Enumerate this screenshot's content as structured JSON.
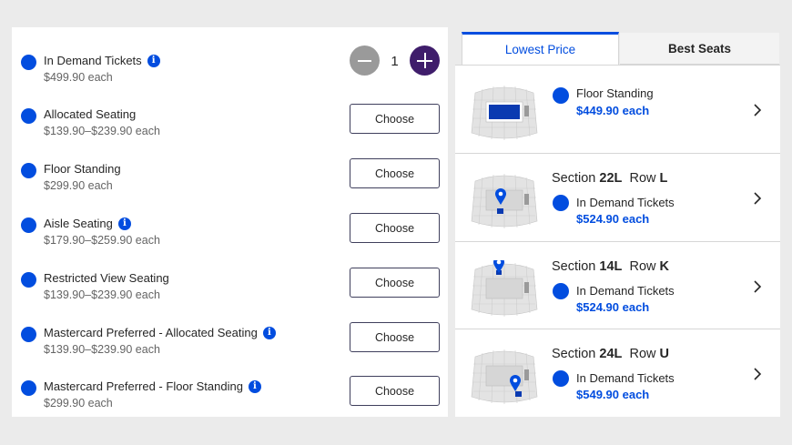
{
  "ticket_types": [
    {
      "name": "In Demand Tickets",
      "price": "$499.90 each",
      "info": true,
      "control": "stepper"
    },
    {
      "name": "Allocated Seating",
      "price": "$139.90–$239.90 each",
      "info": false,
      "control": "choose"
    },
    {
      "name": "Floor Standing",
      "price": "$299.90 each",
      "info": false,
      "control": "choose"
    },
    {
      "name": "Aisle Seating",
      "price": "$179.90–$259.90 each",
      "info": true,
      "control": "choose"
    },
    {
      "name": "Restricted View Seating",
      "price": "$139.90–$239.90 each",
      "info": false,
      "control": "choose"
    },
    {
      "name": "Mastercard Preferred - Allocated Seating",
      "price": "$139.90–$239.90 each",
      "info": true,
      "control": "choose"
    },
    {
      "name": "Mastercard Preferred - Floor Standing",
      "price": "$299.90 each",
      "info": true,
      "control": "choose"
    }
  ],
  "choose_label": "Choose",
  "info_glyph": "i",
  "stepper": {
    "quantity": "1"
  },
  "tabs": {
    "lowest_price": "Lowest Price",
    "best_seats": "Best Seats"
  },
  "listings": [
    {
      "section_word": "",
      "section": "",
      "row_word": "",
      "row": "",
      "type": "Floor Standing",
      "price": "$449.90 each",
      "marker": "floor"
    },
    {
      "section_word": "Section",
      "section": "22L",
      "row_word": "Row",
      "row": "L",
      "type": "In Demand Tickets",
      "price": "$524.90 each",
      "marker": "pin-floor-right"
    },
    {
      "section_word": "Section",
      "section": "14L",
      "row_word": "Row",
      "row": "K",
      "type": "In Demand Tickets",
      "price": "$524.90 each",
      "marker": "pin-top"
    },
    {
      "section_word": "Section",
      "section": "24L",
      "row_word": "Row",
      "row": "U",
      "type": "In Demand Tickets",
      "price": "$549.90 each",
      "marker": "pin-bottom-right"
    }
  ],
  "colors": {
    "accent": "#024ddf",
    "stepper_plus": "#3f1d6b",
    "stepper_minus": "#9a9a9a"
  }
}
